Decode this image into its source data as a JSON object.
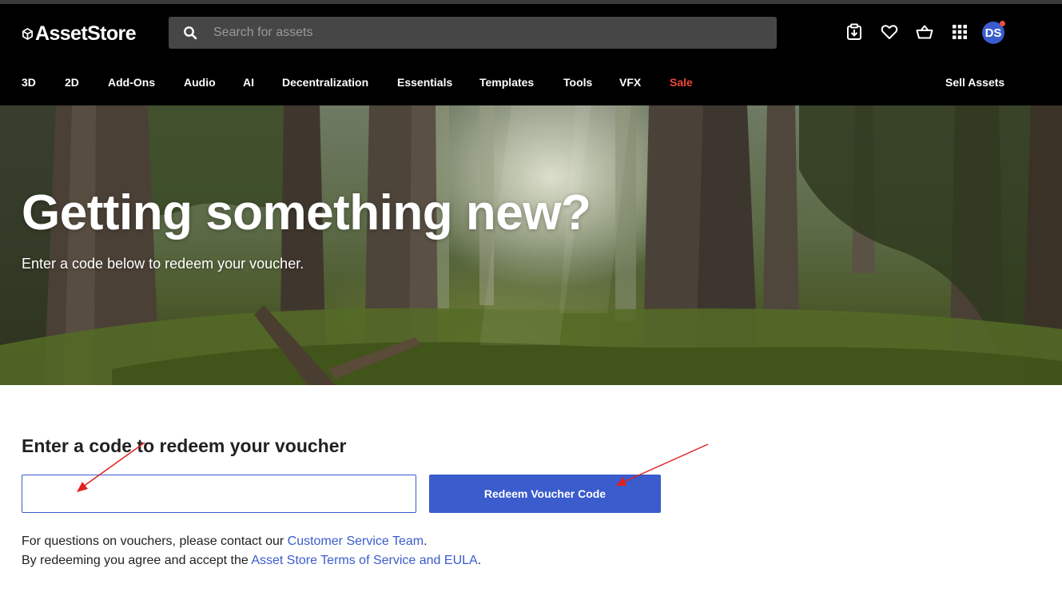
{
  "brand": {
    "logo_text": "AssetStore"
  },
  "search": {
    "placeholder": "Search for assets"
  },
  "header_icons": [
    "downloads-icon",
    "heart-icon",
    "basket-icon",
    "apps-grid-icon"
  ],
  "user": {
    "initials": "DS",
    "notification": true
  },
  "nav": {
    "items": [
      "3D",
      "2D",
      "Add-Ons",
      "Audio",
      "AI",
      "Decentralization",
      "Essentials",
      "Templates",
      "Tools",
      "VFX",
      "Sale"
    ],
    "sell_label": "Sell Assets"
  },
  "hero": {
    "title": "Getting something new?",
    "subtitle": "Enter a code below to redeem your voucher."
  },
  "voucher": {
    "heading": "Enter a code to redeem your voucher",
    "input_value": "",
    "button_label": "Redeem Voucher Code"
  },
  "info": {
    "line1_prefix": "For questions on vouchers, please contact our ",
    "line1_link": "Customer Service Team",
    "line1_suffix": ".",
    "line2_prefix": "By redeeming you agree and accept the ",
    "line2_link": "Asset Store Terms of Service and EULA",
    "line2_suffix": "."
  },
  "colors": {
    "header_bg": "#000000",
    "accent": "#3a5ccc",
    "sale": "#f0453b",
    "annotation_arrow": "#e02020"
  }
}
